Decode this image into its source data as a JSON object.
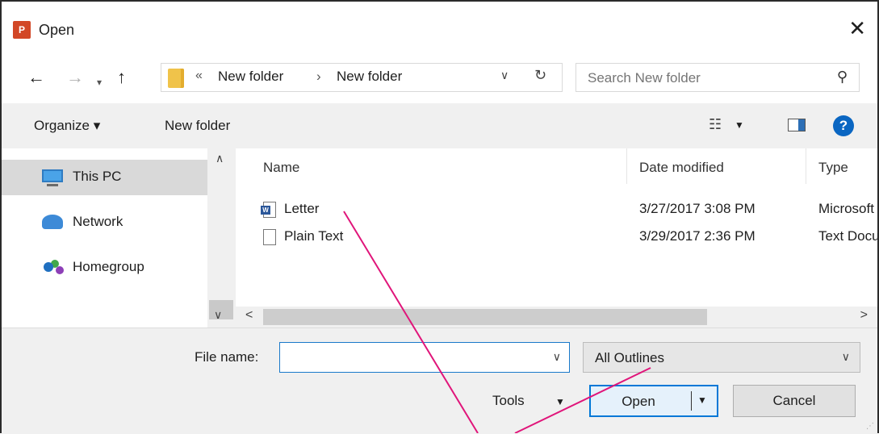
{
  "window": {
    "title": "Open",
    "app_icon": "P"
  },
  "nav": {
    "breadcrumb_chevron": "«",
    "crumbs": [
      "New folder",
      "New folder"
    ],
    "crumb_separator": "›"
  },
  "search": {
    "placeholder": "Search New folder"
  },
  "toolbar": {
    "organize_label": "Organize ▾",
    "new_folder_label": "New folder",
    "help_label": "?"
  },
  "sidebar": {
    "items": [
      {
        "label": "This PC",
        "icon": "monitor-icon",
        "selected": true
      },
      {
        "label": "Network",
        "icon": "network-icon",
        "selected": false
      },
      {
        "label": "Homegroup",
        "icon": "homegroup-icon",
        "selected": false
      }
    ]
  },
  "files": {
    "columns": [
      "Name",
      "Date modified",
      "Type"
    ],
    "rows": [
      {
        "name": "Letter",
        "date": "3/27/2017 3:08 PM",
        "type": "Microsoft",
        "icon": "word-doc-icon"
      },
      {
        "name": "Plain Text",
        "date": "3/29/2017 2:36 PM",
        "type": "Text Docu",
        "icon": "text-doc-icon"
      }
    ]
  },
  "bottom": {
    "file_name_label": "File name:",
    "file_name_value": "",
    "filter_value": "All Outlines",
    "tools_label": "Tools",
    "open_label": "Open",
    "cancel_label": "Cancel"
  },
  "colors": {
    "accent": "#0078d7",
    "callout": "#e0157a",
    "toolbar_bg": "#f0f0f0"
  }
}
